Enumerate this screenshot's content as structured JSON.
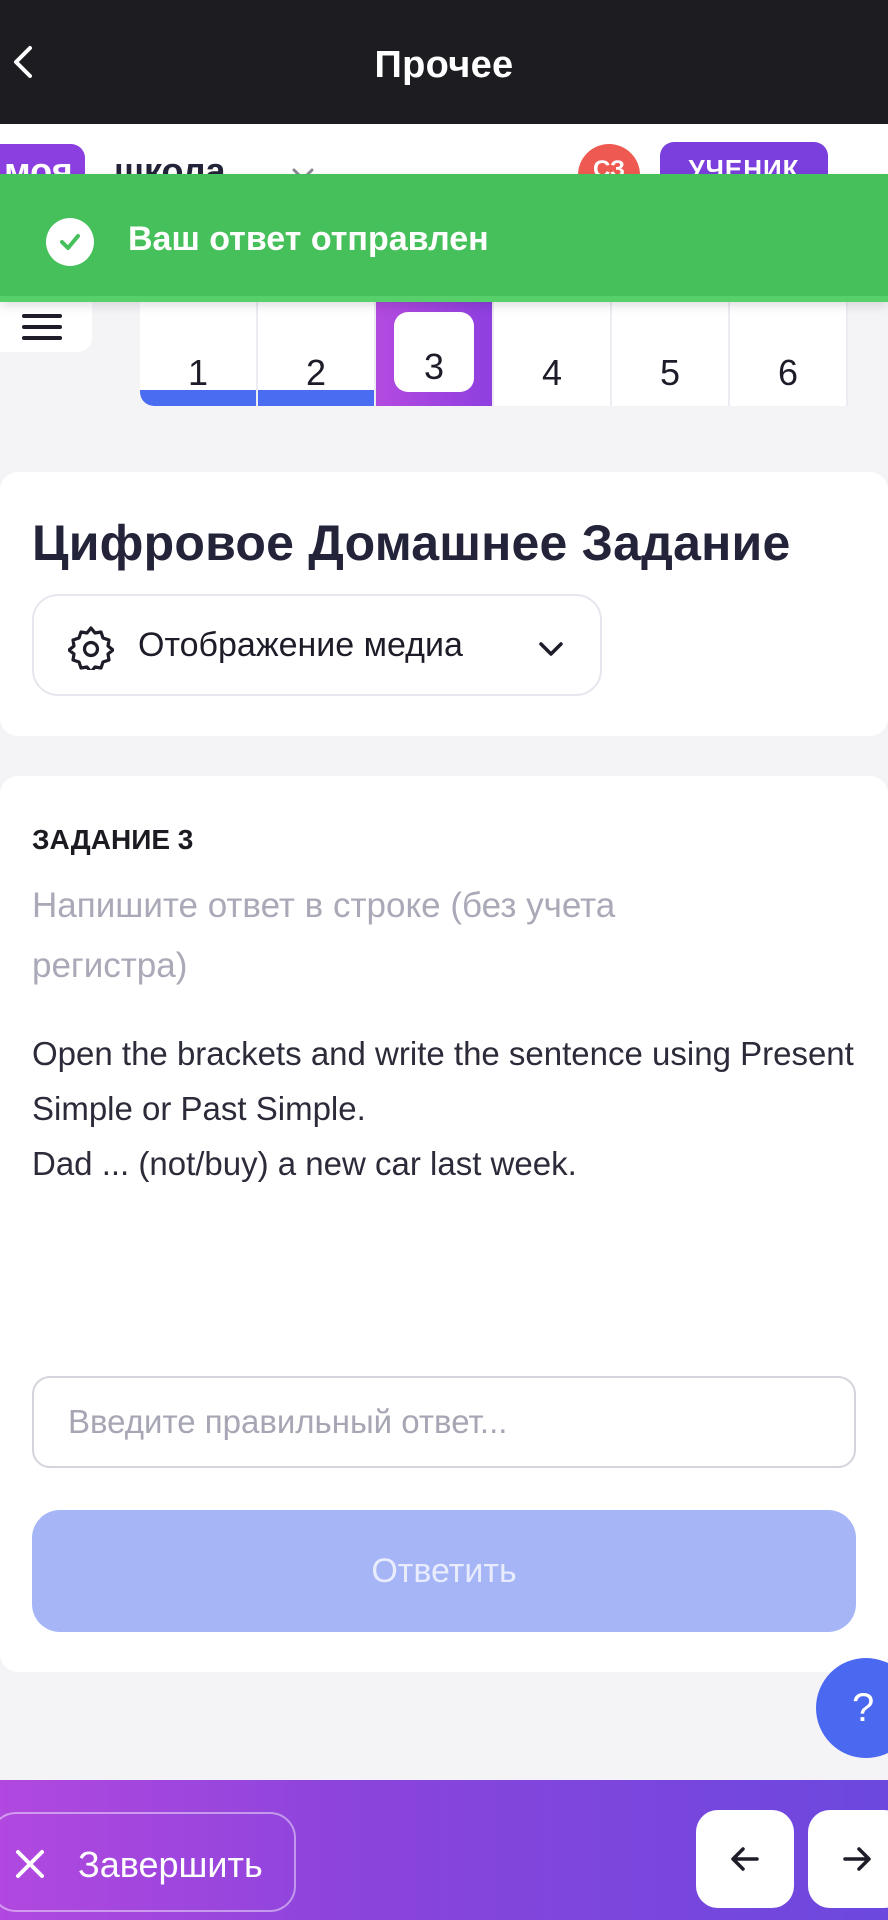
{
  "header": {
    "title": "Прочее"
  },
  "school": {
    "logo_part1": "моя",
    "logo_part2": "школа",
    "avatar_initials": "СЗ",
    "role_label": "УЧЕНИК"
  },
  "toast": {
    "message": "Ваш ответ отправлен"
  },
  "tasks": [
    {
      "label": "1",
      "state": "done"
    },
    {
      "label": "2",
      "state": "done"
    },
    {
      "label": "3",
      "state": "active"
    },
    {
      "label": "4",
      "state": "todo"
    },
    {
      "label": "5",
      "state": "todo"
    },
    {
      "label": "6",
      "state": "todo"
    }
  ],
  "main": {
    "heading": "Цифровое Домашнее Задание",
    "media_dropdown_label": "Отображение медиа"
  },
  "task": {
    "number_label": "ЗАДАНИЕ 3",
    "hint": "Напишите ответ в строке (без учета регистра)",
    "question": "Open the brackets and write the sentence using Present Simple or Past Simple.\nDad ... (not/buy) a new car last week.",
    "answer_placeholder": "Введите правильный ответ...",
    "submit_label": "Ответить"
  },
  "help": {
    "label": "?"
  },
  "footer": {
    "finish_label": "Завершить"
  },
  "colors": {
    "toast": "#45c05a",
    "accent": "#4a6cf0",
    "purple": "#8e3fe0"
  }
}
